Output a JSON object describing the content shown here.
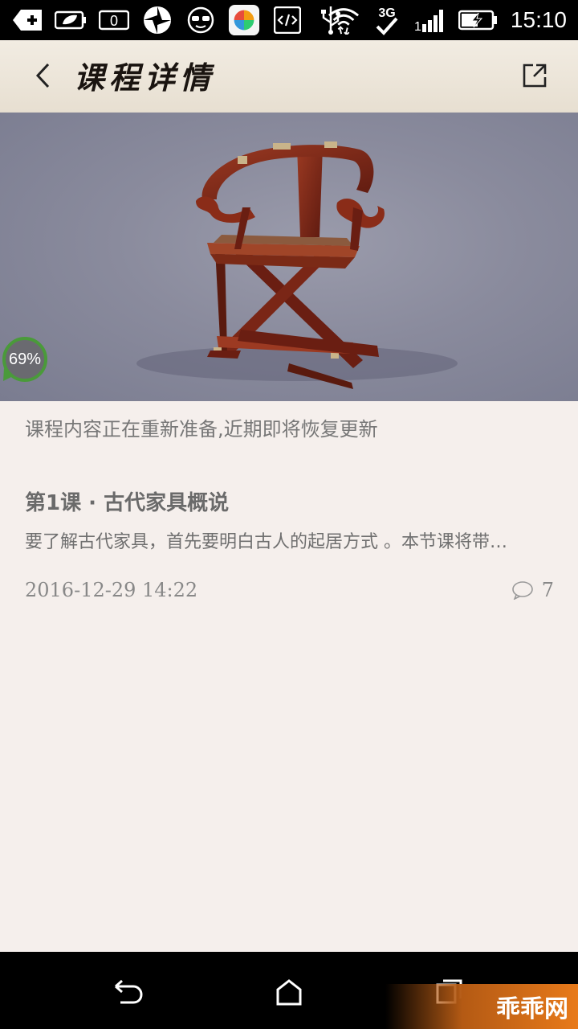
{
  "status_bar": {
    "time": "15:10",
    "notification_count": "0",
    "network": "3G",
    "signal_prefix": "1"
  },
  "header": {
    "title": "课程详情",
    "back_icon": "chevron-left-icon",
    "share_icon": "share-external-icon"
  },
  "hero": {
    "image": "folding-armchair-photo",
    "progress_label": "69%",
    "progress_fraction": 0.69
  },
  "notice": "课程内容正在重新准备,近期即将恢复更新",
  "lessons": [
    {
      "title": "第1课 · 古代家具概说",
      "description": "要了解古代家具，首先要明白古人的起居方式 。本节课将带…",
      "date": "2016-12-29  14:22",
      "comment_count": "7"
    }
  ],
  "nav_bar": {
    "back_icon": "nav-back-icon",
    "home_icon": "nav-home-icon",
    "recents_icon": "nav-recents-icon"
  },
  "watermark": "乖乖网",
  "colors": {
    "background": "#f5efec",
    "header": "#ece5d9",
    "progress_ring": "#4a9a3a",
    "watermark": "#e87a1a"
  }
}
